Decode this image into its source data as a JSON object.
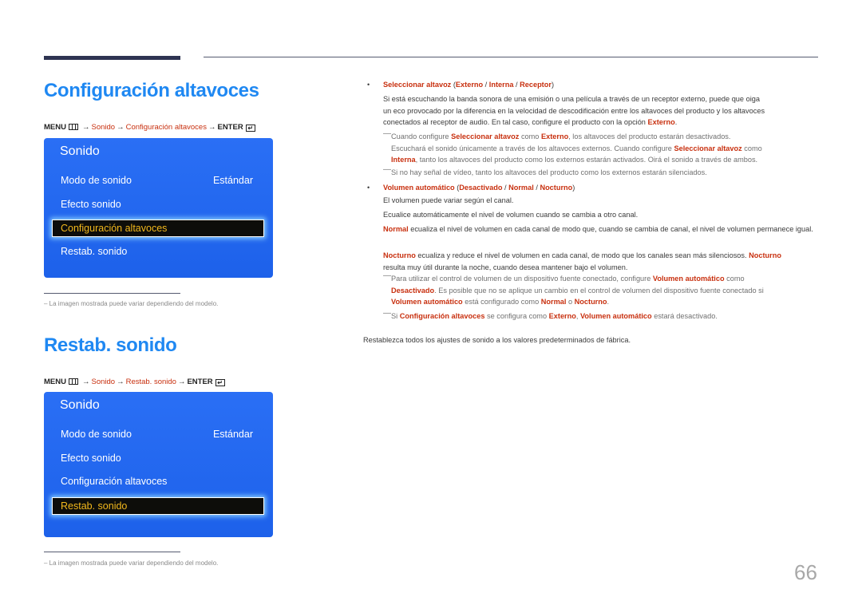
{
  "page_number": "66",
  "sections": [
    {
      "title": "Configuración altavoces",
      "path": {
        "menu": "MENU",
        "crumbs": [
          "Sonido",
          "Configuración altavoces"
        ],
        "enter": "ENTER"
      },
      "panel": {
        "title": "Sonido",
        "items": [
          {
            "label": "Modo de sonido",
            "value": "Estándar"
          },
          {
            "label": "Efecto sonido"
          },
          {
            "label": "Configuración altavoces",
            "selected": true
          },
          {
            "label": "Restab. sonido"
          }
        ]
      },
      "footnote": "La imagen mostrada puede variar dependiendo del modelo."
    },
    {
      "title": "Restab. sonido",
      "path": {
        "menu": "MENU",
        "crumbs": [
          "Sonido",
          "Restab. sonido"
        ],
        "enter": "ENTER"
      },
      "panel": {
        "title": "Sonido",
        "items": [
          {
            "label": "Modo de sonido",
            "value": "Estándar"
          },
          {
            "label": "Efecto sonido"
          },
          {
            "label": "Configuración altavoces"
          },
          {
            "label": "Restab. sonido",
            "selected": true
          }
        ]
      },
      "footnote": "La imagen mostrada puede variar dependiendo del modelo.",
      "description": "Restablezca todos los ajustes de sonido a los valores predeterminados de fábrica."
    }
  ],
  "options": {
    "speaker_select": {
      "name": "Seleccionar altavoz",
      "choices": [
        "Externo",
        "Interna",
        "Receptor"
      ],
      "desc_1": "Si está escuchando la banda sonora de una emisión o una película a través de un receptor externo, puede que oiga",
      "desc_2": "un eco provocado por la diferencia en la velocidad de descodificación entre los altavoces del producto y los altavoces",
      "desc_3": "conectados al receptor de audio. En tal caso, configure el producto con la opción",
      "desc_3_bold": "Externo",
      "note1": {
        "a": "Cuando configure",
        "b": "Seleccionar altavoz",
        "c": "como",
        "d": "Externo",
        "e": ", los altavoces del producto estarán desactivados.",
        "f": "Escuchará el sonido únicamente a través de los altavoces externos. Cuando configure",
        "g": "Seleccionar altavoz",
        "h": "como",
        "i": "Interna",
        "j": ", tanto los altavoces del producto como los externos estarán activados. Oirá el sonido a través de ambos."
      },
      "note2": "Si no hay señal de vídeo, tanto los altavoces del producto como los externos estarán silenciados."
    },
    "auto_volume": {
      "name": "Volumen automático",
      "choices": [
        "Desactivado",
        "Normal",
        "Nocturno"
      ],
      "line1": "El volumen puede variar según el canal.",
      "line2": "Ecualice automáticamente el nivel de volumen cuando se cambia a otro canal.",
      "normal_label": "Normal",
      "normal_desc": "ecualiza el nivel de volumen en cada canal de modo que, cuando se cambia de canal, el nivel de volumen permanece igual.",
      "night_label": "Nocturno",
      "night_desc_1": "ecualiza y reduce el nivel de volumen en cada canal, de modo que los canales sean más silenciosos.",
      "night_desc_2": "resulta muy útil durante la noche, cuando desea mantener bajo el volumen.",
      "note1": {
        "a": "Para utilizar el control de volumen de un dispositivo fuente conectado, configure",
        "b": "Volumen automático",
        "c": "como",
        "d": "Desactivado",
        "e": ". Es posible que no se aplique un cambio en el control de volumen del dispositivo fuente conectado si",
        "f": "Volumen automático",
        "g": "está configurado como",
        "h": "Normal",
        "i": "o",
        "j": "Nocturno",
        "k": "."
      },
      "note2": {
        "a": "Si",
        "b": "Configuración altavoces",
        "c": "se configura como",
        "d": "Externo",
        "e": ",",
        "f": "Volumen automático",
        "g": "estará desactivado."
      }
    }
  },
  "colors": {
    "heading": "#1f88f2",
    "highlight": "#c8300f",
    "panel_bg": "#1f66f0",
    "selected_text": "#f2b81c"
  }
}
